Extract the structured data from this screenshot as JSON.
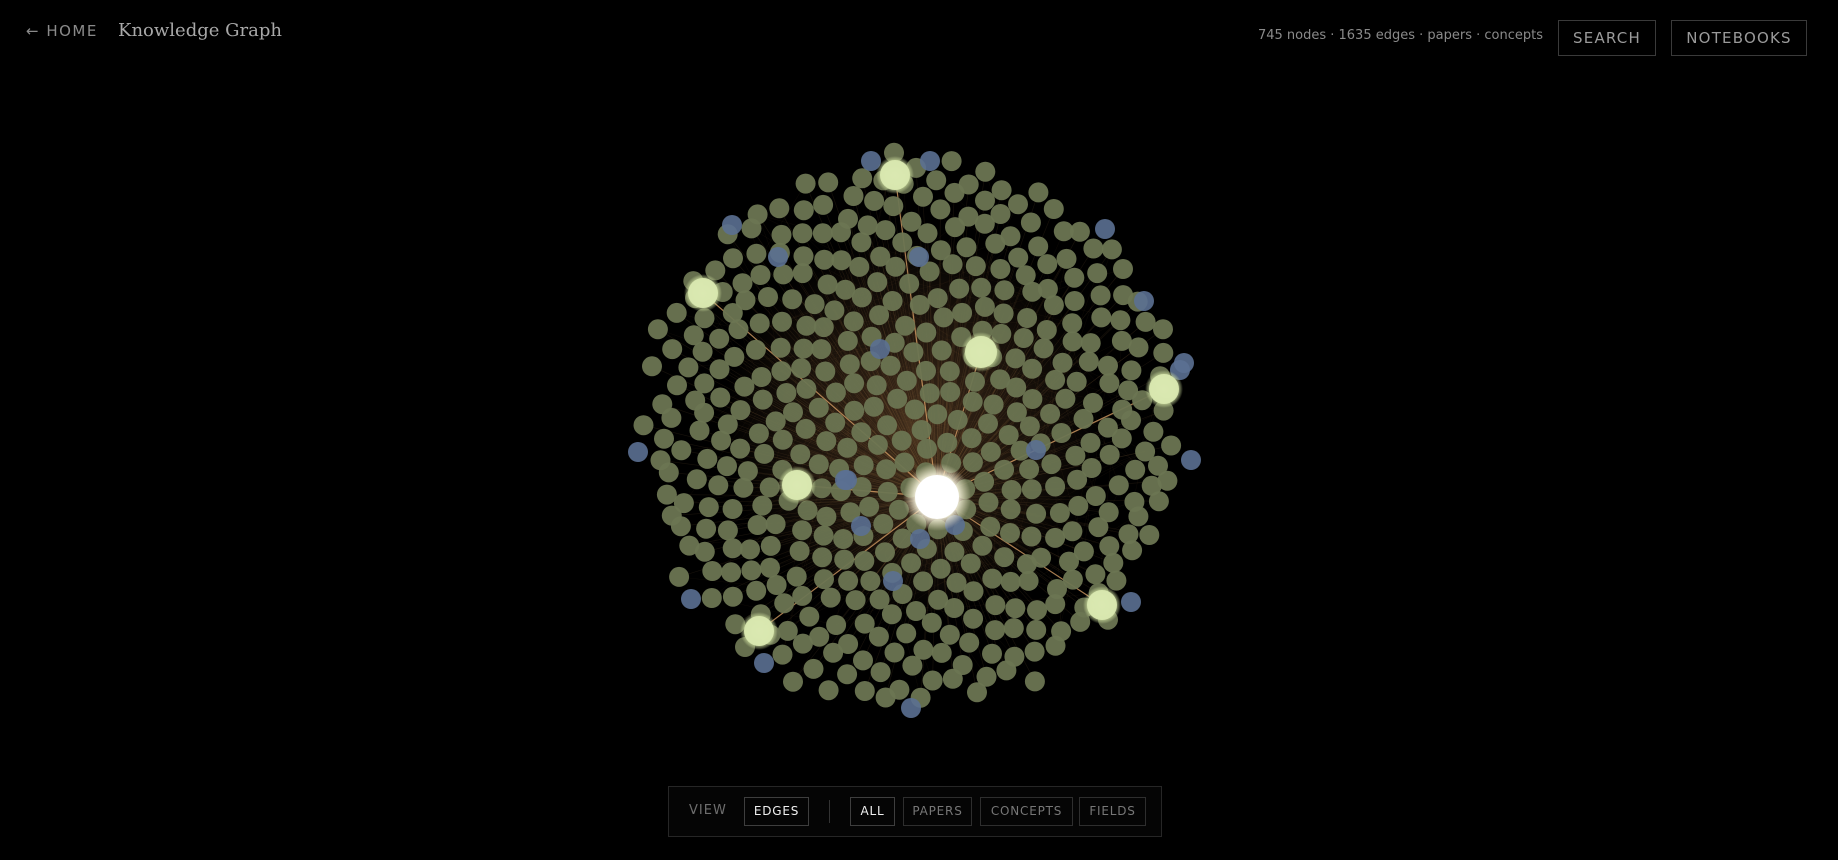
{
  "header": {
    "home_label": "← HOME",
    "title": "Knowledge Graph",
    "stats": "745 nodes · 1635 edges · papers · concepts",
    "search_label": "SEARCH",
    "notebooks_label": "NOTEBOOKS"
  },
  "toolbar": {
    "view_label": "VIEW",
    "edges_label": "EDGES",
    "filters": [
      {
        "label": "ALL",
        "active": true
      },
      {
        "label": "PAPERS",
        "active": false
      },
      {
        "label": "CONCEPTS",
        "active": false
      },
      {
        "label": "FIELDS",
        "active": false
      }
    ]
  },
  "graph": {
    "node_count": 745,
    "edge_count": 1635,
    "colors": {
      "background": "#000000",
      "paper_node": "#6c7552",
      "concept_node": "#5b7092",
      "hub_node": "#d9e8b0",
      "center_node": "#ffffff",
      "edge": "#c8925a"
    }
  }
}
